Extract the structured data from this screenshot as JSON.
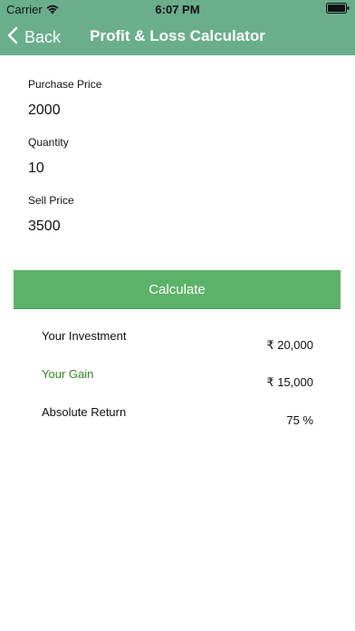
{
  "status_bar": {
    "carrier": "Carrier",
    "time": "6:07 PM",
    "wifi_icon": "wifi-icon",
    "battery_icon": "battery-icon"
  },
  "nav": {
    "back_label": "Back",
    "title": "Profit & Loss Calculator",
    "background": "#6aae8c"
  },
  "form": {
    "purchase_price": {
      "label": "Purchase Price",
      "value": "2000"
    },
    "quantity": {
      "label": "Quantity",
      "value": "10"
    },
    "sell_price": {
      "label": "Sell Price",
      "value": "3500"
    }
  },
  "calculate_button": {
    "label": "Calculate",
    "color": "#5cb268"
  },
  "results": {
    "investment": {
      "label": "Your Investment",
      "value": "₹ 20,000"
    },
    "gain": {
      "label": "Your Gain",
      "value": "₹ 15,000",
      "color": "#2e8b1e"
    },
    "absolute_return": {
      "label": "Absolute Return",
      "value": "75 %"
    }
  }
}
